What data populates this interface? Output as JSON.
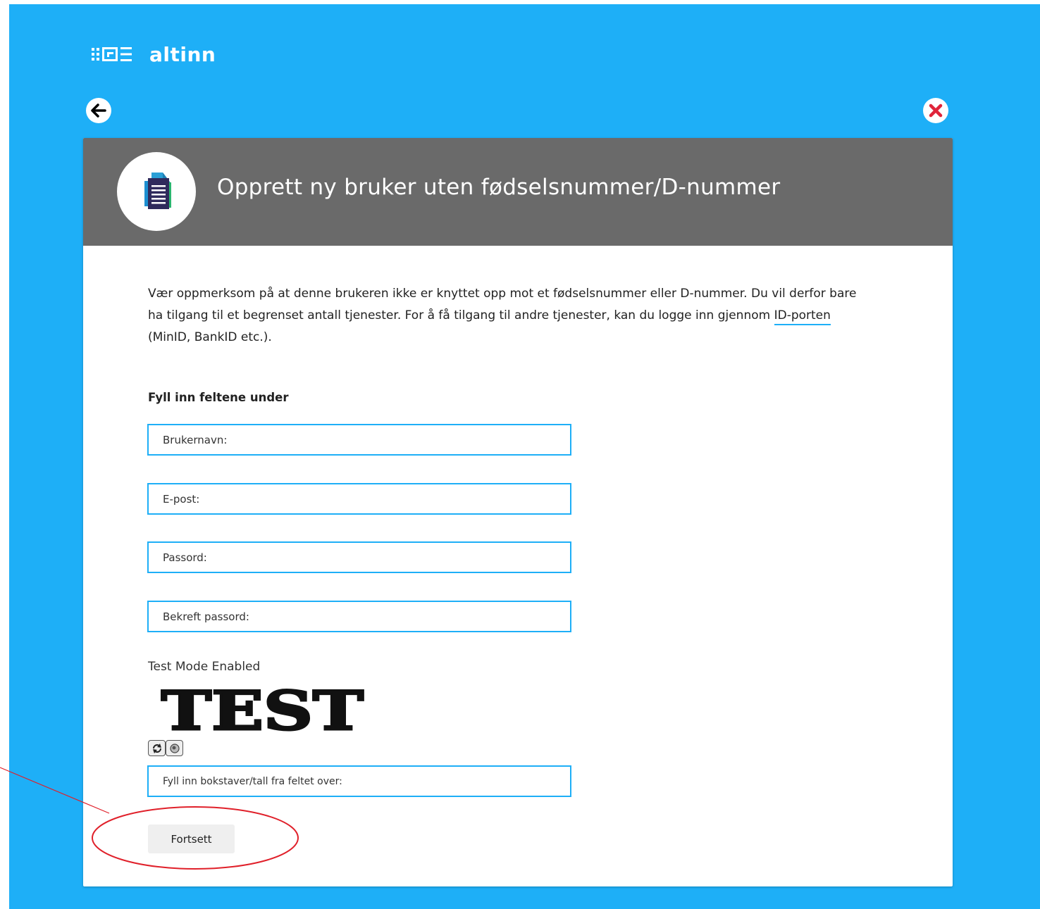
{
  "brand": {
    "logo_text": "altinn"
  },
  "nav": {
    "back_icon": "arrow-left-icon",
    "close_icon": "close-icon"
  },
  "header": {
    "icon": "document-icon",
    "title": "Opprett ny bruker uten fødselsnummer/D-nummer"
  },
  "intro": {
    "text_before": "Vær oppmerksom på at denne brukeren ikke er knyttet opp mot et fødselsnummer eller D-nummer. Du vil derfor bare ha tilgang til et begrenset antall tjenester. For å få tilgang til andre tjenester, kan du logge inn gjennom ",
    "link_text": "ID-porten",
    "text_after": " (MinID, BankID etc.)."
  },
  "form": {
    "section_title": "Fyll inn feltene under",
    "fields": [
      {
        "placeholder": "Brukernavn:",
        "value": ""
      },
      {
        "placeholder": "E-post:",
        "value": ""
      },
      {
        "placeholder": "Passord:",
        "value": ""
      },
      {
        "placeholder": "Bekreft passord:",
        "value": ""
      }
    ],
    "test_mode_text": "Test Mode Enabled",
    "captcha_text": "TEST",
    "captcha_field": {
      "placeholder": "Fyll inn bokstaver/tall fra feltet over:",
      "value": ""
    },
    "continue_label": "Fortsett"
  },
  "colors": {
    "background": "#1eaff7",
    "header": "#6a6a6a",
    "field_border": "#1eaff7",
    "annotation": "#e0202a"
  }
}
